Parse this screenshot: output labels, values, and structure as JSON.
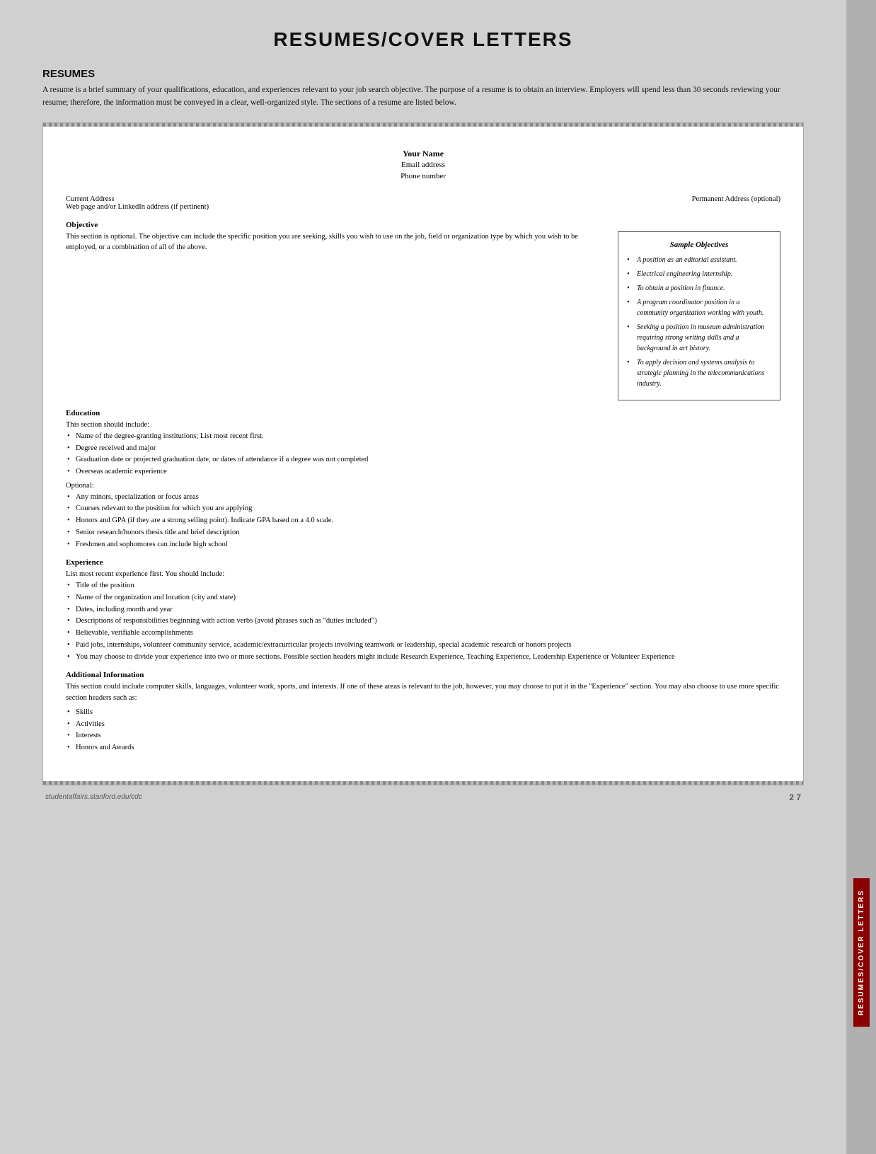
{
  "page": {
    "title": "RESUMES/COVER LETTERS",
    "footer_url": "studentaffairs.stanford.edu/cdc",
    "footer_page": "2 7"
  },
  "sidebar": {
    "tab_label": "RESUMES/COVER LETTERS"
  },
  "resumes_section": {
    "heading": "RESUMES",
    "intro": "A resume is a brief summary of your qualifications, education, and experiences relevant to your job search objective. The purpose of a resume is to obtain an interview. Employers will spend less than 30 seconds reviewing your resume; therefore, the information must be conveyed in a clear, well-organized style. The sections of a resume are listed below."
  },
  "resume_template": {
    "name": "Your Name",
    "email": "Email address",
    "phone": "Phone number",
    "current_address_label": "Current Address",
    "web_label": "Web page and/or LinkedIn address (if pertinent)",
    "permanent_address_label": "Permanent Address (optional)"
  },
  "objective_section": {
    "title": "Objective",
    "body": "This section is optional. The objective can include the specific position you are seeking, skills you wish to use on the job, field or organization type by which you wish to be employed, or a combination of all of the above."
  },
  "sample_objectives": {
    "box_title": "Sample Objectives",
    "items": [
      "A position as an editorial assistant.",
      "Electrical engineering internship.",
      "To obtain a position in finance.",
      "A program coordinator position in a community organization working with youth.",
      "Seeking a position in museum administration requiring strong writing skills and a background in art history.",
      "To apply decision and systems analysis to strategic planning in the telecommunications industry."
    ]
  },
  "education_section": {
    "title": "Education",
    "intro": "This section should include:",
    "required_items": [
      "Name of the degree-granting institutions; List most recent first.",
      "Degree received and major",
      "Graduation date or projected graduation date, or dates of attendance if a degree was not completed",
      "Overseas academic experience"
    ],
    "optional_label": "Optional:",
    "optional_items": [
      "Any minors, specialization or focus areas",
      "Courses relevant to the position for which you are applying",
      "Honors and GPA (if they are a strong selling point). Indicate GPA based on a 4.0 scale.",
      "Senior research/honors thesis title and brief description",
      "Freshmen and sophomores can include high school"
    ]
  },
  "experience_section": {
    "title": "Experience",
    "intro": "List most recent experience first. You should include:",
    "items": [
      "Title of the position",
      "Name of the organization and location (city and state)",
      "Dates, including month and year",
      "Descriptions of responsibilities beginning with action verbs (avoid phrases such as \"duties included\")",
      "Believable, verifiable accomplishments",
      "Paid jobs, internships, volunteer community service, academic/extracurricular projects involving teamwork or leadership, special academic research or honors projects",
      "You may choose to divide your experience into two or more sections. Possible section headers might include Research Experience, Teaching Experience, Leadership Experience or Volunteer Experience"
    ]
  },
  "additional_section": {
    "title": "Additional Information",
    "intro": "This section could include computer skills, languages, volunteer work, sports, and interests. If one of these areas is relevant to the job, however, you may choose to put it in the \"Experience\" section. You may also choose to use more specific section headers such as:",
    "items": [
      "Skills",
      "Activities",
      "Interests",
      "Honors and Awards"
    ]
  }
}
